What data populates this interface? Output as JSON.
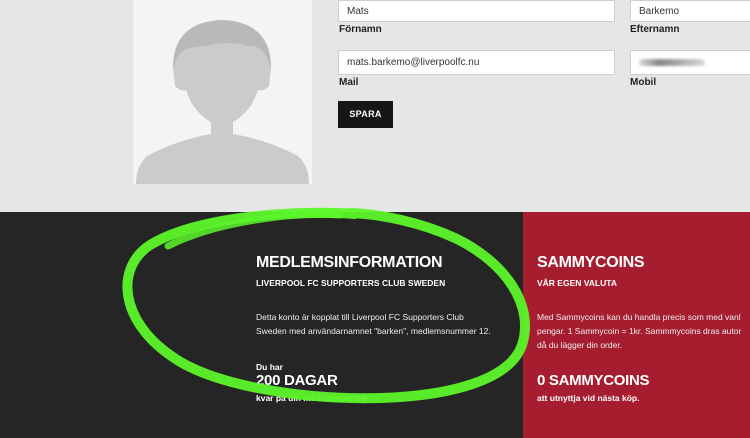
{
  "profile": {
    "first_name_value": "Mats",
    "first_name_label": "Förnamn",
    "last_name_value": "Barkemo",
    "last_name_label": "Efternamn",
    "email_value": "mats.barkemo@liverpoolfc.nu",
    "email_label": "Mail",
    "phone_label": "Mobil",
    "save_label": "SPARA"
  },
  "membership": {
    "title": "MEDLEMSINFORMATION",
    "subtitle": "LIVERPOOL FC SUPPORTERS CLUB SWEDEN",
    "description_lines": [
      "Detta konto är kopplat till Liverpool FC Supporters Club",
      "Sweden med användarnamnet \"barken\", medlemsnummer 12."
    ],
    "du_har": "Du har",
    "days": "200 DAGAR",
    "days_caption": "kvar på din medlemsperiod"
  },
  "sammycoins": {
    "title": "SAMMYCOINS",
    "subtitle": "VÅR EGEN VALUTA",
    "description_lines": [
      "Med Sammycoins kan du handla precis som med vanl",
      "pengar. 1 Sammycoin = 1kr. Sammmycoins dras autor",
      "då du lägger din order."
    ],
    "balance": "0 SAMMYCOINS",
    "balance_caption": "att utnyttja vid nästa köp."
  },
  "colors": {
    "top_bg": "#e6e6e6",
    "dark_panel": "#252525",
    "red_panel": "#a51d2f",
    "annotation_green": "#5cf52a"
  },
  "icons": {
    "avatar": "default-user-silhouette-icon",
    "annotation": "green-hand-drawn-circle"
  }
}
